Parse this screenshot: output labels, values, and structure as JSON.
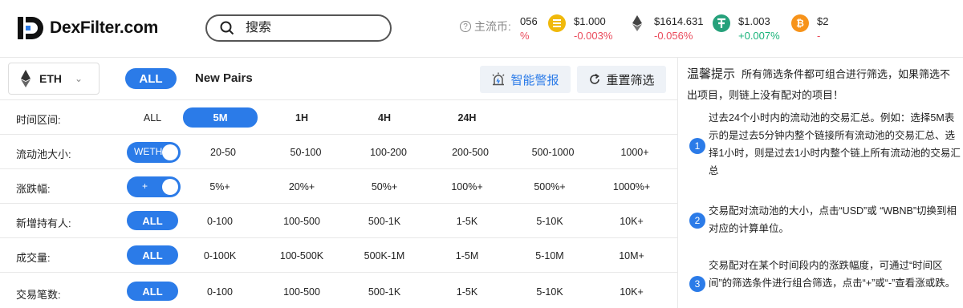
{
  "header": {
    "logo_text": "DexFilter.com",
    "search_placeholder": "搜索",
    "mainstream_label": "主流币:",
    "tickers": [
      {
        "icon": "partial-coin-icon",
        "price": "056",
        "change": "%",
        "trend": "neg",
        "color": "#ffffff"
      },
      {
        "icon": "busd-icon",
        "price": "$1.000",
        "change": "-0.003%",
        "trend": "neg",
        "color": "#f0b90b"
      },
      {
        "icon": "eth-icon",
        "price": "$1614.631",
        "change": "-0.056%",
        "trend": "neg",
        "color": "#ffffff"
      },
      {
        "icon": "usdt-icon",
        "price": "$1.003",
        "change": "+0.007%",
        "trend": "pos",
        "color": "#26a17b"
      },
      {
        "icon": "btc-icon",
        "price": "$2",
        "change": "-",
        "trend": "neg",
        "color": "#f7931a"
      }
    ]
  },
  "toolbar": {
    "chain": "ETH",
    "all_label": "ALL",
    "new_pairs_label": "New Pairs",
    "alert_label": "智能警报",
    "reset_label": "重置筛选"
  },
  "filters": {
    "time": {
      "label": "时间区间:",
      "options": [
        "ALL",
        "5M",
        "1H",
        "4H",
        "24H"
      ],
      "selected": "5M"
    },
    "pool": {
      "label": "流动池大小:",
      "toggle": "WETH",
      "options": [
        "20-50",
        "50-100",
        "100-200",
        "200-500",
        "500-1000",
        "1000+"
      ]
    },
    "change": {
      "label": "涨跌幅:",
      "toggle": "+",
      "options": [
        "5%+",
        "20%+",
        "50%+",
        "100%+",
        "500%+",
        "1000%+"
      ]
    },
    "holders": {
      "label": "新增持有人:",
      "all": "ALL",
      "options": [
        "0-100",
        "100-500",
        "500-1K",
        "1-5K",
        "5-10K",
        "10K+"
      ]
    },
    "volume": {
      "label": "成交量:",
      "all": "ALL",
      "options": [
        "0-100K",
        "100-500K",
        "500K-1M",
        "1-5M",
        "5-10M",
        "10M+"
      ]
    },
    "txns": {
      "label": "交易笔数:",
      "all": "ALL",
      "options": [
        "0-100",
        "100-500",
        "500-1K",
        "1-5K",
        "5-10K",
        "10K+"
      ]
    }
  },
  "tips": {
    "title": "温馨提示",
    "intro": "所有筛选条件都可组合进行筛选，如果筛选不出项目，则链上没有配对的项目！",
    "items": [
      {
        "num": "1",
        "text": "过去24个小时内的流动池的交易汇总。例如：选择5M表示的是过去5分钟内整个链接所有流动池的交易汇总、选择1小时，则是过去1小时内整个链上所有流动池的交易汇总"
      },
      {
        "num": "2",
        "text": "交易配对流动池的大小，点击“USD”或 “WBNB”切换到相对应的计算单位。"
      },
      {
        "num": "3",
        "text": "交易配对在某个时间段内的涨跌幅度，可通过“时间区间”的筛选条件进行组合筛选，点击“+”或“-”查看涨或跌。"
      }
    ]
  }
}
